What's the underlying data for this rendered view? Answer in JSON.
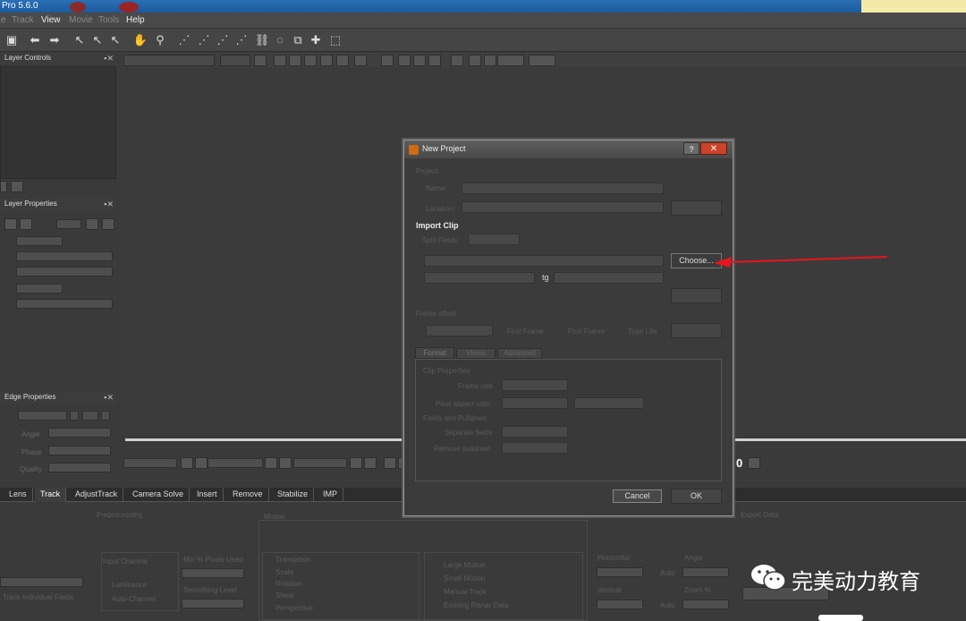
{
  "app": {
    "title_fragment": "Pro 5.6.0"
  },
  "menu": [
    "e",
    "Track",
    "View",
    "Movie",
    "Tools",
    "Help"
  ],
  "panels": {
    "layer_controls": "Layer Controls",
    "layer_properties": "Layer Properties",
    "edge_properties": "Edge Properties",
    "edge_fields": [
      "Angle",
      "Phase",
      "Quality"
    ]
  },
  "tabs": [
    "Lens",
    "Track",
    "AdjustTrack",
    "Camera Solve",
    "Insert",
    "Remove",
    "Stabilize",
    "IMP"
  ],
  "active_tab": "Track",
  "bottom": {
    "preprocessing": "Preprocessing",
    "motion": "Motion",
    "exact_data": "Export Data",
    "input_channel": "Input Channel",
    "luminance": "Luminance",
    "auto_channel": "Auto-Channel",
    "min_pixels": "Min % Pixels Used",
    "smoothing": "Smoothing Level",
    "track_individual": "Track Individual Fields",
    "motion_opts": [
      "Translation",
      "Scale",
      "Rotation",
      "Shear",
      "Perspective"
    ],
    "motion_types": [
      "Large Motion",
      "Small Motion",
      "Manual Track",
      "Existing Planar Data"
    ],
    "horizontal": "Horizontal",
    "vertical": "Vertical",
    "angle": "Angle",
    "zoom": "Zoom %",
    "auto": "Auto"
  },
  "dialog": {
    "title": "New Project",
    "help": "?",
    "close": "✕",
    "project_hdr": "Project",
    "name_lbl": "Name:",
    "location_lbl": "Location:",
    "import_clip_hdr": "Import Clip",
    "split_fields_lbl": "Split Fields:",
    "choose_btn": "Choose...",
    "tg_label": "tg",
    "frame_offset": "Frame offset",
    "first_frame": "First Frame",
    "first_frame2": "First Frame",
    "tabs": [
      "Format",
      "Views",
      "Advanced"
    ],
    "clip_properties": "Clip Properties",
    "frame_rate": "Frame rate",
    "pixel_aspect": "Pixel aspect ratio",
    "fields_pulldown": "Fields and Pulldown",
    "separate_fields": "Separate fields",
    "remove_pulldown": "Remove pulldown",
    "cancel_btn": "Cancel",
    "ok_btn": "OK"
  },
  "watermark": "完美动力教育",
  "timeline_frame": "0"
}
